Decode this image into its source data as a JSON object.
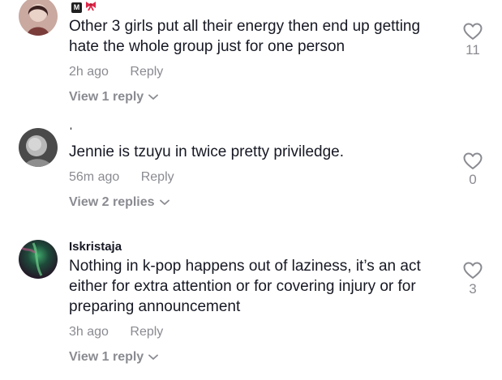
{
  "comments": [
    {
      "username": "",
      "username_badges": [
        "M-icon",
        "ribbon-icon"
      ],
      "text": "Other 3 girls put all their energy then end up getting hate the whole group just for one person",
      "time": "2h ago",
      "reply_label": "Reply",
      "likes": "11",
      "view_replies": "View 1 reply"
    },
    {
      "username": "ˈ",
      "text": "Jennie is tzuyu in twice pretty priviledge.",
      "time": "56m ago",
      "reply_label": "Reply",
      "likes": "0",
      "view_replies": "View 2 replies"
    },
    {
      "username": "Iskristaja",
      "text": "Nothing in k-pop happens out of laziness, it’s an act either for extra attention or for covering injury or for preparing announcement",
      "time": "3h ago",
      "reply_label": "Reply",
      "likes": "3",
      "view_replies": "View 1 reply"
    }
  ],
  "colors": {
    "text": "#161823",
    "muted": "#8a8b91",
    "ribbon": "#e0284a"
  },
  "icons": {
    "like": "heart-outline-icon",
    "expand": "chevron-down-icon"
  }
}
